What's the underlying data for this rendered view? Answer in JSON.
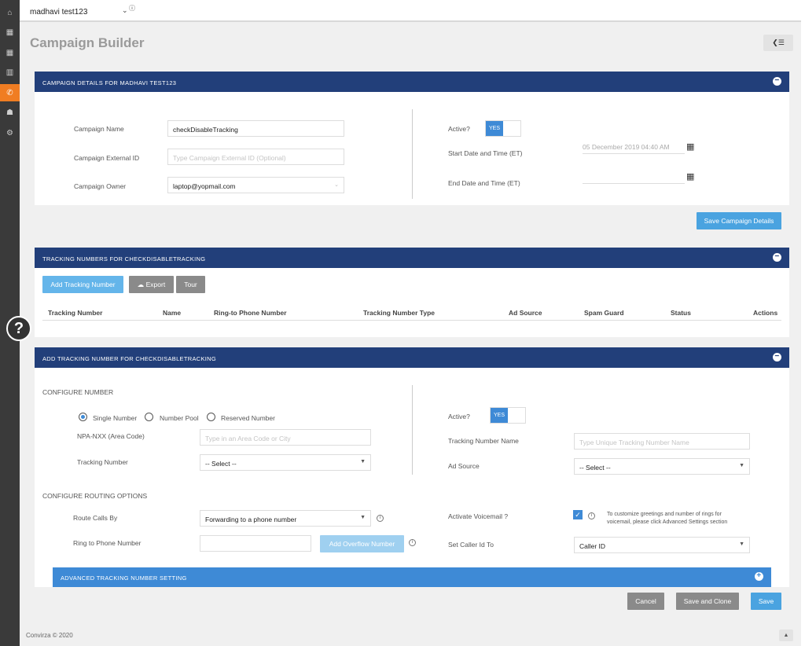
{
  "sidebar": {
    "items": [
      {
        "icon": "home-icon"
      },
      {
        "icon": "chart-icon"
      },
      {
        "icon": "chart-icon"
      },
      {
        "icon": "book-icon"
      },
      {
        "icon": "phone-icon"
      },
      {
        "icon": "users-icon"
      },
      {
        "icon": "gear-icon"
      }
    ],
    "active_color": "#f07d22"
  },
  "topbar": {
    "account": "madhavi test123"
  },
  "page": {
    "title": "Campaign Builder",
    "help": "?"
  },
  "campaign": {
    "header": "CAMPAIGN DETAILS FOR MADHAVI TEST123",
    "name_label": "Campaign Name",
    "name_value": "checkDisableTracking",
    "ext_label": "Campaign External ID",
    "ext_placeholder": "Type Campaign External ID (Optional)",
    "owner_label": "Campaign Owner",
    "owner_value": "laptop@yopmail.com",
    "active_label": "Active?",
    "active_value": "YES",
    "start_label": "Start Date and Time (ET)",
    "start_value": "05 December 2019 04:40 AM",
    "end_label": "End Date and Time (ET)",
    "save_label": "Save Campaign Details"
  },
  "tracking": {
    "header": "TRACKING NUMBERS FOR CHECKDISABLETRACKING",
    "add_label": "Add Tracking Number",
    "export_label": "Export",
    "tour_label": "Tour",
    "columns": [
      "Tracking Number",
      "Name",
      "Ring-to Phone Number",
      "Tracking Number Type",
      "Ad Source",
      "Spam Guard",
      "Status",
      "Actions"
    ]
  },
  "add": {
    "header": "ADD TRACKING NUMBER FOR CHECKDISABLETRACKING",
    "configure_number": "CONFIGURE NUMBER",
    "radio_single": "Single Number",
    "radio_pool": "Number Pool",
    "radio_reserved": "Reserved Number",
    "npa_label": "NPA-NXX (Area Code)",
    "npa_placeholder": "Type in an Area Code or City",
    "tn_label": "Tracking Number",
    "tn_value": "-- Select --",
    "active_label": "Active?",
    "active_value": "YES",
    "tn_name_label": "Tracking Number Name",
    "tn_name_placeholder": "Type Unique Tracking Number Name",
    "ad_label": "Ad Source",
    "ad_value": "-- Select --",
    "routing": "CONFIGURE ROUTING OPTIONS",
    "route_label": "Route Calls By",
    "route_value": "Forwarding to a phone number",
    "ring_label": "Ring to Phone Number",
    "overflow_label": "Add Overflow Number",
    "voicemail_label": "Activate Voicemail ?",
    "voicemail_note_1": "To customize greetings and number of rings for",
    "voicemail_note_2": "voicemail, please click Advanced Settings section",
    "caller_label": "Set Caller Id To",
    "caller_value": "Caller ID",
    "advanced": "ADVANCED TRACKING NUMBER SETTING",
    "cancel": "Cancel",
    "save_clone": "Save and Clone",
    "save": "Save"
  },
  "footer": {
    "copyright": "Convirza © 2020"
  }
}
